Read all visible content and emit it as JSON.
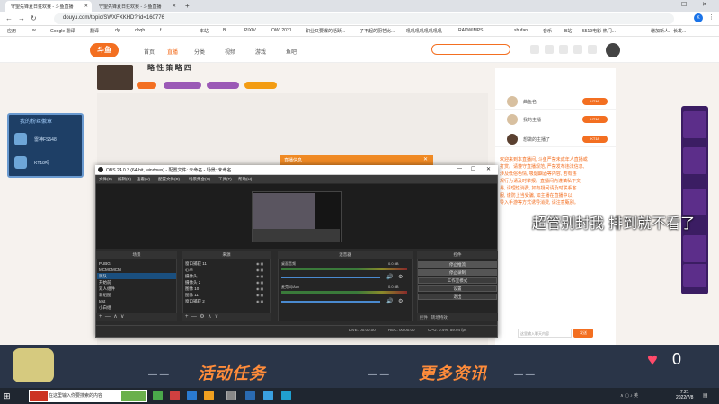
{
  "browser": {
    "tabs": [
      {
        "label": "守望先锋夏日狂欢赛 - 斗鱼直播"
      },
      {
        "label": "守望先锋夏日狂欢赛 - 斗鱼直播"
      }
    ],
    "new_tab": "+",
    "url": "douyu.com/topic/SWXFXKHD?rid=160776",
    "back": "←",
    "forward": "→",
    "reload": "↻",
    "bookmarks": [
      "应用",
      "w",
      "Google 翻译",
      "翻译",
      "dy",
      "dbqb",
      "f",
      "",
      "",
      "本站",
      "B",
      "PIXIV",
      "OWL2021",
      "职业又要爆的活跃...",
      "了不起的厨艺比...",
      "吼吼吼吼吼吼吼吼",
      "RADWIMPS",
      "shufan",
      "音乐",
      "B站",
      "5519电影-热门...",
      "增加新人、长发..."
    ]
  },
  "site": {
    "logo": "斗鱼",
    "nav": [
      "首页",
      "直播",
      "分类",
      "视频",
      "游戏",
      "鱼吧"
    ],
    "nav_active": 1,
    "streamer_name": "略 性 策 略 四",
    "tags": [
      "斗鱼",
      "5800",
      "全民"
    ],
    "tag_colors": [
      "#f36f21",
      "#9b59b6",
      "#9b59b6",
      "#f39c12"
    ]
  },
  "left_panel": {
    "title": "我的粉丝徽章",
    "items": [
      "雷神FS548",
      "KT18吗"
    ]
  },
  "right_panel": {
    "rows": [
      {
        "name": "曲鱼名",
        "badge": "KT18"
      },
      {
        "name": "我的主播",
        "badge": "KT18"
      },
      {
        "name": "想做的主播了",
        "badge": "KT18"
      }
    ],
    "chat_lines": [
      "欢迎来到本直播间, 斗鱼严禁未成年人直播或",
      "打赏。请遵守直播规范, 严禁发布违法信息,",
      "涉及低俗色情, 吸烟酗酒等内容, 若有违",
      "规行为请及时举报。直播间内谨慎私下交",
      "易, 请理性消费, 如有疑问请及时联系客",
      "服, 谨防上当受骗, 如主播在直播中以",
      "导入手游等方式诱导消费, 请注意甄别。"
    ],
    "input_placeholder": "这里输入聊天内容",
    "send": "发送"
  },
  "danmu": "超管别封我 排到就不看了",
  "obs": {
    "title": "OBS 24.0.3 (64-bit, windows) - 配置文件: 未命名 - 场景: 未命名",
    "menus": [
      "文件(F)",
      "编辑(E)",
      "查看(V)",
      "配置文件(P)",
      "场景集合(S)",
      "工具(T)",
      "帮助(H)"
    ],
    "ctl_min": "—",
    "ctl_max": "☐",
    "ctl_close": "✕",
    "scenes_header": "场景",
    "scenes": [
      "PUBG",
      "MCMCMCM",
      "跳队",
      "开始前",
      "双人组件",
      "新组图",
      "test",
      "小白组"
    ],
    "scene_selected": 2,
    "sources_header": "来源",
    "sources": [
      "窗口捕获 11",
      "心率",
      "摄像头",
      "摄像头 2",
      "图像 10",
      "图像 11",
      "窗口捕获 2"
    ],
    "mixer_header": "混音器",
    "mixer": [
      {
        "label": "桌面音频",
        "db": "0.0 dB"
      },
      {
        "label": "麦克风/Aux",
        "db": "0.0 dB"
      },
      {
        "label": "麦克风/Aux",
        "db": "0.0 dB"
      }
    ],
    "controls_header": "控件",
    "controls": [
      "停止推流",
      "停止录制",
      "工作室模式",
      "设置",
      "退出"
    ],
    "controls_highlight": [
      0,
      1
    ],
    "bottom_tabs": [
      "控件",
      "转场特效"
    ],
    "status": {
      "live": "LIVE: 00:00:00",
      "rec": "REC: 00:00:00",
      "cpu": "CPU: 0.4%, 59.94 fps"
    },
    "dock_foot_icons": [
      "+",
      "—",
      "∧",
      "∨"
    ]
  },
  "notification": {
    "title": "直播信息",
    "close": "✕"
  },
  "banner": {
    "left_text": "活动任务",
    "right_text": "更多资讯",
    "likes": "0"
  },
  "taskbar": {
    "search_placeholder": "在这里输入你要搜索的内容",
    "time": "7:21",
    "date": "2022/7/8",
    "icon_colors": [
      "#4aa84a",
      "#d04040",
      "#2a7ad0",
      "#f0a020",
      "#888888",
      "#2a6ab0",
      "#3aa0e0",
      "#20a0d0"
    ]
  }
}
